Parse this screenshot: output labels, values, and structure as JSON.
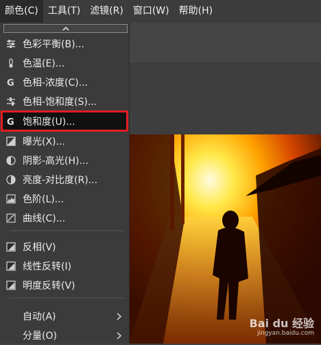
{
  "menubar": {
    "items": [
      "颜色(C)",
      "工具(T)",
      "滤镜(R)",
      "窗口(W)",
      "帮助(H)"
    ]
  },
  "colors_menu": {
    "items": [
      {
        "label": "色彩平衡(B)...",
        "icon": "color-balance-icon"
      },
      {
        "label": "色温(E)...",
        "icon": "color-temperature-icon"
      },
      {
        "label": "色相-浓度(C)...",
        "icon": "gegl-icon"
      },
      {
        "label": "色相-饱和度(S)...",
        "icon": "hue-saturation-icon"
      },
      {
        "label": "饱和度(U)...",
        "icon": "gegl-icon",
        "highlighted": true
      },
      {
        "label": "曝光(X)...",
        "icon": "exposure-icon"
      },
      {
        "label": "阴影-高光(H)...",
        "icon": "shadows-highlights-icon"
      },
      {
        "label": "亮度-对比度(R)...",
        "icon": "brightness-contrast-icon"
      },
      {
        "label": "色阶(L)...",
        "icon": "levels-icon"
      },
      {
        "label": "曲线(C)...",
        "icon": "curves-icon"
      },
      {
        "label": "反相(V)",
        "icon": "invert-icon"
      },
      {
        "label": "线性反转(I)",
        "icon": "linear-invert-icon"
      },
      {
        "label": "明度反转(V)",
        "icon": "value-invert-icon"
      },
      {
        "label": "自动(A)",
        "submenu": true
      },
      {
        "label": "分量(O)",
        "submenu": true
      }
    ]
  },
  "watermark": {
    "logo": "Bai du 经验",
    "url": "jingyan.baidu.com"
  }
}
